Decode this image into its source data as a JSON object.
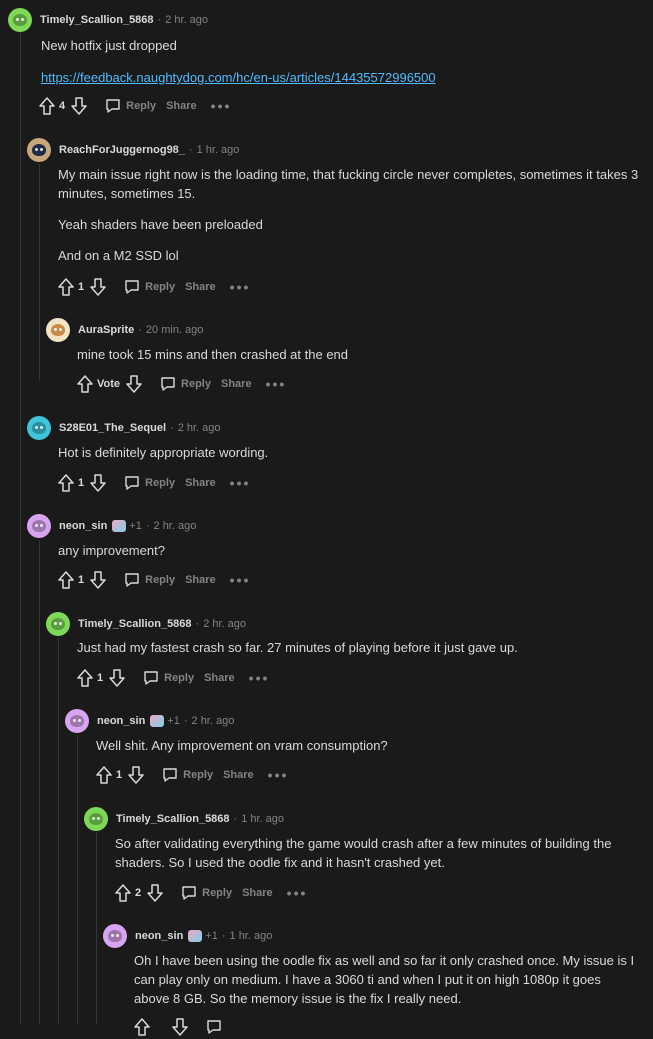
{
  "comments": [
    {
      "user": "Timely_Scallion_5868",
      "time": "2 hr. ago",
      "avatar_color": "#7ed957",
      "body": [
        "New hotfix just dropped"
      ],
      "link": "https://feedback.naughtydog.com/hc/en-us/articles/14435572996500",
      "score": "4",
      "reply_label": "Reply",
      "share_label": "Share",
      "more_label": "•••"
    },
    {
      "user": "ReachForJuggernog98_",
      "time": "1 hr. ago",
      "avatar_color": "#c9a77c",
      "body": [
        "My main issue right now is the loading time, that fucking circle never completes, sometimes it takes 3 minutes, sometimes 15.",
        "Yeah shaders have been preloaded",
        "And on a M2 SSD lol"
      ],
      "score": "1",
      "reply_label": "Reply",
      "share_label": "Share",
      "more_label": "•••"
    },
    {
      "user": "AuraSprite",
      "time": "20 min. ago",
      "avatar_color": "#f3e3c5",
      "body": [
        "mine took 15 mins and then crashed at the end"
      ],
      "score": "Vote",
      "reply_label": "Reply",
      "share_label": "Share",
      "more_label": "•••"
    },
    {
      "user": "S28E01_The_Sequel",
      "time": "2 hr. ago",
      "avatar_color": "#3fc5d8",
      "body": [
        "Hot is definitely appropriate wording."
      ],
      "score": "1",
      "reply_label": "Reply",
      "share_label": "Share",
      "more_label": "•••"
    },
    {
      "user": "neon_sin",
      "flair_count": "+1",
      "time": "2 hr. ago",
      "avatar_color": "#d7a4f0",
      "body": [
        "any improvement?"
      ],
      "score": "1",
      "reply_label": "Reply",
      "share_label": "Share",
      "more_label": "•••"
    },
    {
      "user": "Timely_Scallion_5868",
      "time": "2 hr. ago",
      "avatar_color": "#7ed957",
      "body": [
        "Just had my fastest crash so far. 27 minutes of playing before it just gave up."
      ],
      "score": "1",
      "reply_label": "Reply",
      "share_label": "Share",
      "more_label": "•••"
    },
    {
      "user": "neon_sin",
      "flair_count": "+1",
      "time": "2 hr. ago",
      "avatar_color": "#d7a4f0",
      "body": [
        "Well shit. Any improvement on vram consumption?"
      ],
      "score": "1",
      "reply_label": "Reply",
      "share_label": "Share",
      "more_label": "•••"
    },
    {
      "user": "Timely_Scallion_5868",
      "time": "1 hr. ago",
      "avatar_color": "#7ed957",
      "body": [
        "So after validating everything the game would crash after a few minutes of building the shaders. So I used the oodle fix and it hasn't crashed yet."
      ],
      "score": "2",
      "reply_label": "Reply",
      "share_label": "Share",
      "more_label": "•••"
    },
    {
      "user": "neon_sin",
      "flair_count": "+1",
      "time": "1 hr. ago",
      "avatar_color": "#d7a4f0",
      "body": [
        "Oh I have been using the oodle fix as well and so far it only crashed once. My issue is I can play only on medium. I have a 3060 ti and when I put it on high 1080p it goes above 8 GB. So the memory issue is the fix I really need."
      ]
    }
  ]
}
